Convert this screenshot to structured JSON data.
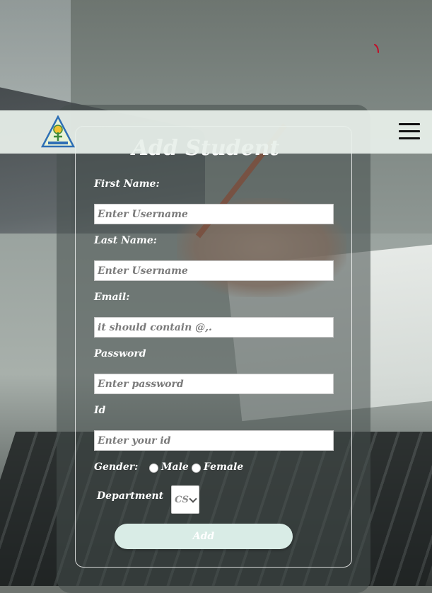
{
  "form": {
    "title": "Add Student",
    "fields": [
      {
        "label": "First Name:",
        "placeholder": "Enter Username"
      },
      {
        "label": "Last Name:",
        "placeholder": "Enter Username"
      },
      {
        "label": "Email:",
        "placeholder": "it should contain @,."
      },
      {
        "label": "Password",
        "placeholder": "Enter password"
      },
      {
        "label": "Id",
        "placeholder": "Enter your id"
      }
    ],
    "gender": {
      "label": "Gender:",
      "options": [
        "Male",
        "Female"
      ]
    },
    "department": {
      "label": "Department",
      "selected": "CS"
    },
    "submit_label": "Add"
  },
  "navbar": {
    "logo_icon": "university-logo",
    "menu_icon": "hamburger-menu-icon"
  },
  "colors": {
    "navbar_bg": "#e8f0eb",
    "button_bg": "#d9ece6",
    "spinner": "#c0102a"
  }
}
